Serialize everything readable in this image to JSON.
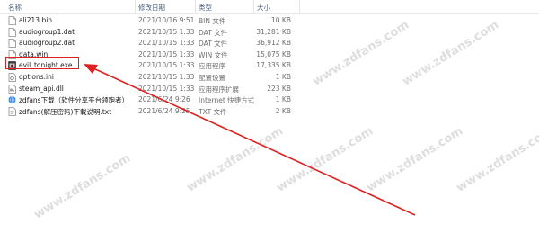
{
  "columns": {
    "name": "名称",
    "date": "修改日期",
    "type": "类型",
    "size": "大小"
  },
  "files": [
    {
      "name": "ali213.bin",
      "date": "2021/10/16 9:51",
      "type": "BIN 文件",
      "size": "10 KB",
      "icon": "file-icon"
    },
    {
      "name": "audiogroup1.dat",
      "date": "2021/10/15 1:33",
      "type": "DAT 文件",
      "size": "31,281 KB",
      "icon": "file-icon"
    },
    {
      "name": "audiogroup2.dat",
      "date": "2021/10/15 1:33",
      "type": "DAT 文件",
      "size": "36,912 KB",
      "icon": "file-icon"
    },
    {
      "name": "data.win",
      "date": "2021/10/15 1:33",
      "type": "WIN 文件",
      "size": "15,075 KB",
      "icon": "file-icon"
    },
    {
      "name": "evil_tonight.exe",
      "date": "2021/10/15 1:33",
      "type": "应用程序",
      "size": "17,335 KB",
      "icon": "exe-icon"
    },
    {
      "name": "options.ini",
      "date": "2021/10/15 1:33",
      "type": "配置设置",
      "size": "1 KB",
      "icon": "settings-file-icon"
    },
    {
      "name": "steam_api.dll",
      "date": "2021/10/15 1:33",
      "type": "应用程序扩展",
      "size": "223 KB",
      "icon": "dll-icon"
    },
    {
      "name": "zdfans下载（软件分享平台领跑者）",
      "date": "2021/6/24 9:26",
      "type": "Internet 快捷方式",
      "size": "1 KB",
      "icon": "internet-shortcut-icon"
    },
    {
      "name": "zdfans(解压密码)下载说明.txt",
      "date": "2021/6/24 9:25",
      "type": "TXT 文件",
      "size": "2 KB",
      "icon": "text-file-icon"
    }
  ],
  "watermark": "www.zdfans.com",
  "colors": {
    "annotation": "#e0201e",
    "header_text": "#4d6082"
  }
}
